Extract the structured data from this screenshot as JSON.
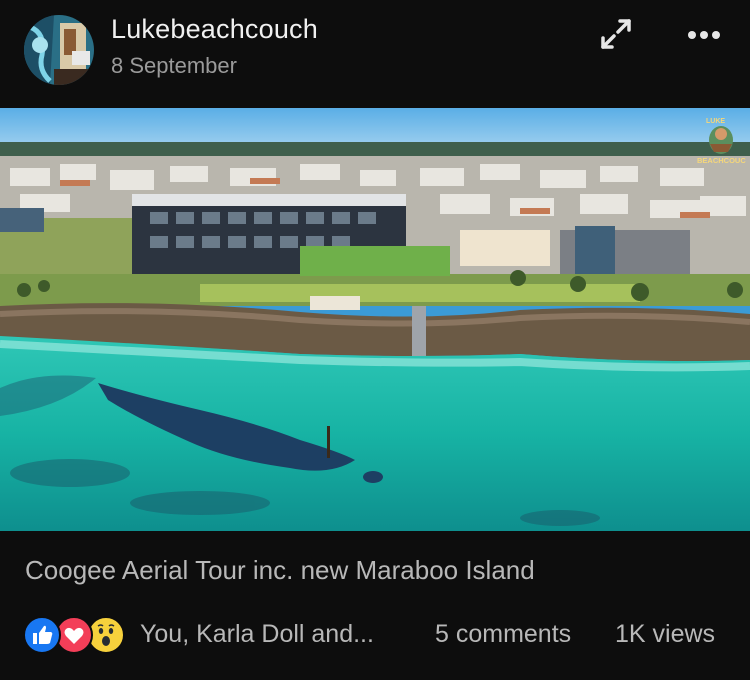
{
  "post": {
    "author": "Lukebeachcouch",
    "date": "8 September",
    "caption": "Coogee Aerial Tour inc. new Maraboo Island"
  },
  "video": {
    "channel_logo_text_top": "LUKE",
    "channel_logo_text_bottom": "BEACHCOUCH"
  },
  "stats": {
    "reacted_by": "You, Karla Doll and...",
    "comments": "5 comments",
    "views": "1K views"
  },
  "icons": {
    "expand": "expand-arrows-icon",
    "more": "more-dots-icon",
    "reactions": [
      "like-reaction-icon",
      "love-reaction-icon",
      "wow-reaction-icon"
    ]
  },
  "colors": {
    "background": "#0d0d0d",
    "like": "#1877f2",
    "love": "#f33e58",
    "wow": "#f7d13c"
  }
}
